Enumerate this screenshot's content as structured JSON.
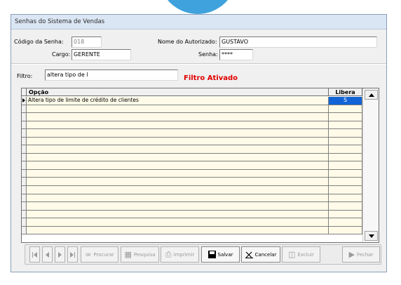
{
  "window": {
    "title": "Senhas do Sistema de Vendas"
  },
  "form": {
    "codigo_label": "Código da Senha:",
    "codigo_value": "018",
    "autorizado_label": "Nome do Autorizado:",
    "autorizado_value": "GUSTAVO",
    "cargo_label": "Cargo:",
    "cargo_value": "GERENTE",
    "senha_label": "Senha:",
    "senha_value": "****"
  },
  "filter": {
    "label": "Filtro:",
    "value": "altera tipo de l",
    "status": "Filtro Ativado",
    "status_color": "#e00000"
  },
  "grid": {
    "columns": {
      "opcao": "Opção",
      "libera": "Libera"
    },
    "rows": [
      {
        "opcao": "Altera tipo de limite de crédito de clientes",
        "libera": "S",
        "selected": true
      }
    ],
    "empty_rows": 16,
    "selection_color": "#1163d6"
  },
  "toolbar": {
    "procurar": "Procurar",
    "pesquisa": "Pesquisa",
    "imprimir": "Imprimir",
    "salvar": "Salvar",
    "cancelar": "Cancelar",
    "excluir": "Excluir",
    "fechar": "Fechar"
  }
}
